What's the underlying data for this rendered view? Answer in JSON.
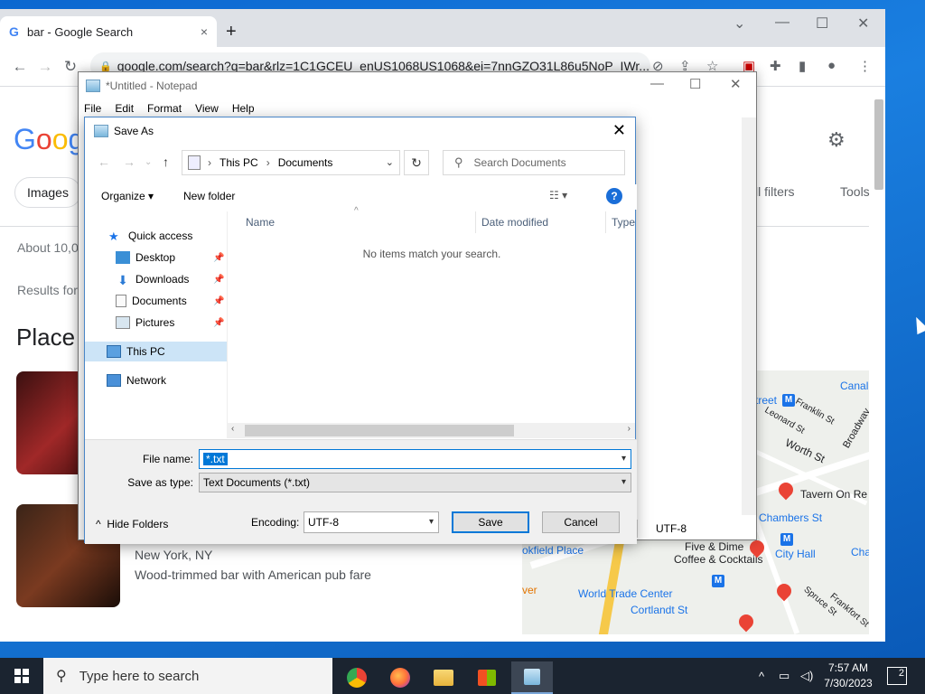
{
  "chrome": {
    "tab_title": "bar - Google Search",
    "tab_close": "×",
    "new_tab": "+",
    "url": "google.com/search?q=bar&rlz=1C1GCEU_enUS1068US1068&ei=7nnGZO31L86u5NoP_IWr...",
    "google_logo_letters": [
      "G",
      "o",
      "o",
      "g"
    ],
    "chip_images": "Images",
    "all_filters": "ll filters",
    "tools": "Tools",
    "about": "About 10,0",
    "results_for": "Results for",
    "places": "Place",
    "listing_location": "New York, NY",
    "listing_desc": "Wood-trimmed bar with American pub fare",
    "map_labels": {
      "canal": "Canal",
      "street": "treet",
      "leonard": "Leonard St",
      "franklin": "Franklin St",
      "broadway": "Broadway",
      "worth": "Worth St",
      "tavern": "Tavern On Re",
      "chambers": "Chambers St",
      "five_dime": "Five & Dime",
      "coffee": "Coffee & Cocktails",
      "cityhall": "City Hall",
      "cha": "Cha",
      "okfield": "okfield Place",
      "wtc": "World Trade Center",
      "cortlandt": "Cortlandt St",
      "ver": "ver",
      "spruce": "Spruce St",
      "frankfort": "Frankfort St"
    }
  },
  "notepad": {
    "title": "*Untitled - Notepad",
    "menu": [
      "File",
      "Edit",
      "Format",
      "View",
      "Help"
    ],
    "status_encoding": "UTF-8"
  },
  "saveas": {
    "title": "Save As",
    "address": {
      "root": "This PC",
      "folder": "Documents"
    },
    "search_placeholder": "Search Documents",
    "organize": "Organize",
    "new_folder": "New folder",
    "help": "?",
    "nav": {
      "quick_access": "Quick access",
      "desktop": "Desktop",
      "downloads": "Downloads",
      "documents": "Documents",
      "pictures": "Pictures",
      "this_pc": "This PC",
      "network": "Network"
    },
    "columns": {
      "name": "Name",
      "date": "Date modified",
      "type": "Type"
    },
    "empty_message": "No items match your search.",
    "file_name_label": "File name:",
    "file_name_value": "*.txt",
    "save_type_label": "Save as type:",
    "save_type_value": "Text Documents (*.txt)",
    "hide_folders": "Hide Folders",
    "encoding_label": "Encoding:",
    "encoding_value": "UTF-8",
    "save_button": "Save",
    "cancel_button": "Cancel"
  },
  "taskbar": {
    "search_placeholder": "Type here to search",
    "time": "7:57 AM",
    "date": "7/30/2023",
    "notifications": "2"
  },
  "colors": {
    "accent": "#0078d7",
    "taskbar": "#1b2430",
    "desktop": "#0b67d0"
  }
}
